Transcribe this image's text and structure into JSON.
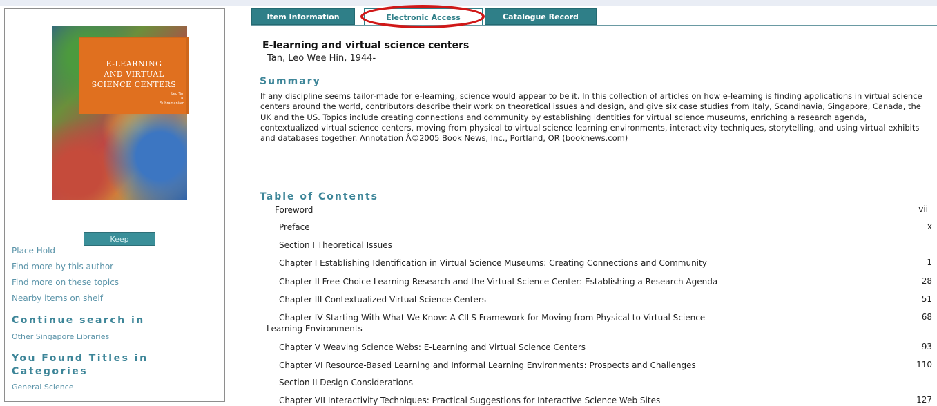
{
  "tabs": {
    "item_information": "Item Information",
    "electronic_access": "Electronic Access",
    "catalogue_record": "Catalogue Record"
  },
  "cover": {
    "title_line1": "E-LEARNING",
    "title_line2": "AND VIRTUAL",
    "title_line3": "SCIENCE CENTERS",
    "authors_line1": "Leo Tan",
    "authors_line2": "R. Subramaniam"
  },
  "left_panel": {
    "keep_label": "Keep",
    "links": [
      "Place Hold",
      "Find more by this author",
      "Find more on these topics",
      "Nearby items on shelf"
    ],
    "continue_heading": "Continue search in",
    "continue_link": "Other Singapore Libraries",
    "categories_heading_line1": "You Found Titles in",
    "categories_heading_line2": "Categories",
    "category_link": "General Science"
  },
  "book": {
    "title": "E-learning and virtual science centers",
    "author": "Tan, Leo Wee Hin, 1944-"
  },
  "summary": {
    "heading": "Summary",
    "text": "If any discipline seems tailor-made for e-learning, science would appear to be it. In this collection of articles on how e-learning is finding applications in virtual science centers around the world, contributors describe their work on theoretical issues and design, and give six case studies from Italy, Scandinavia, Singapore, Canada, the UK and the US. Topics include creating connections and community by establishing identities for virtual science museums, enriching a research agenda, contextualized virtual science centers, moving from physical to virtual science learning environments, interactivity techniques, storytelling, and using virtual exhibits and databases together. Annotation Â©2005 Book News, Inc., Portland, OR (booknews.com)"
  },
  "toc": {
    "heading": "Table of Contents",
    "entries": [
      {
        "label": "Foreword",
        "page": "vii"
      },
      {
        "label": "Preface",
        "page": "x"
      },
      {
        "label": "Section I Theoretical Issues",
        "page": ""
      },
      {
        "label": "Chapter I Establishing Identification in Virtual Science Museums: Creating Connections and Community",
        "page": "1"
      },
      {
        "label": "Chapter II Free-Choice Learning Research and the Virtual Science Center: Establishing a Research Agenda",
        "page": "28"
      },
      {
        "label": "Chapter III Contextualized Virtual Science Centers",
        "page": "51"
      },
      {
        "label": "Chapter IV Starting With What We Know: A CILS Framework for Moving from Physical to Virtual Science",
        "label2": "Learning Environments",
        "page": "68"
      },
      {
        "label": "Chapter V Weaving Science Webs: E-Learning and Virtual Science Centers",
        "page": "93"
      },
      {
        "label": "Chapter VI Resource-Based Learning and Informal Learning Environments: Prospects and Challenges",
        "page": "110"
      },
      {
        "label": "Section II Design Considerations",
        "page": ""
      },
      {
        "label": "Chapter VII Interactivity Techniques: Practical Suggestions for Interactive Science Web Sites",
        "page": "127"
      }
    ]
  },
  "colors": {
    "accent": "#2f7f88",
    "heading": "#3d8598",
    "link": "#5b94a9",
    "highlight": "#d01818"
  }
}
